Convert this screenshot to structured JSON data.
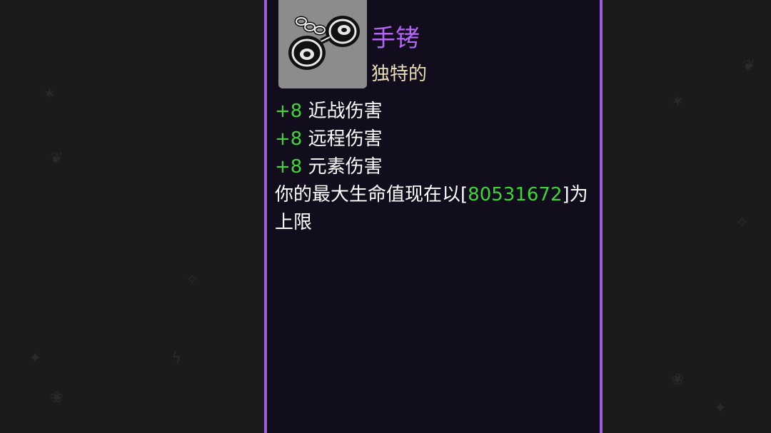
{
  "tooltip": {
    "item_name": "手铐",
    "rarity": "独特的",
    "icon": "handcuffs-icon",
    "stats": [
      {
        "value": "+8",
        "label": "近战伤害"
      },
      {
        "value": "+8",
        "label": "远程伤害"
      },
      {
        "value": "+8",
        "label": "元素伤害"
      }
    ],
    "effect": {
      "prefix": "你的最大生命值现在以[",
      "number": "80531672",
      "suffix": "]为上限"
    }
  },
  "colors": {
    "border": "#9a5fd8",
    "item_name": "#b267f0",
    "rarity": "#e9dcb8",
    "positive_value": "#42d23a",
    "panel_bg": "#120d1c"
  }
}
